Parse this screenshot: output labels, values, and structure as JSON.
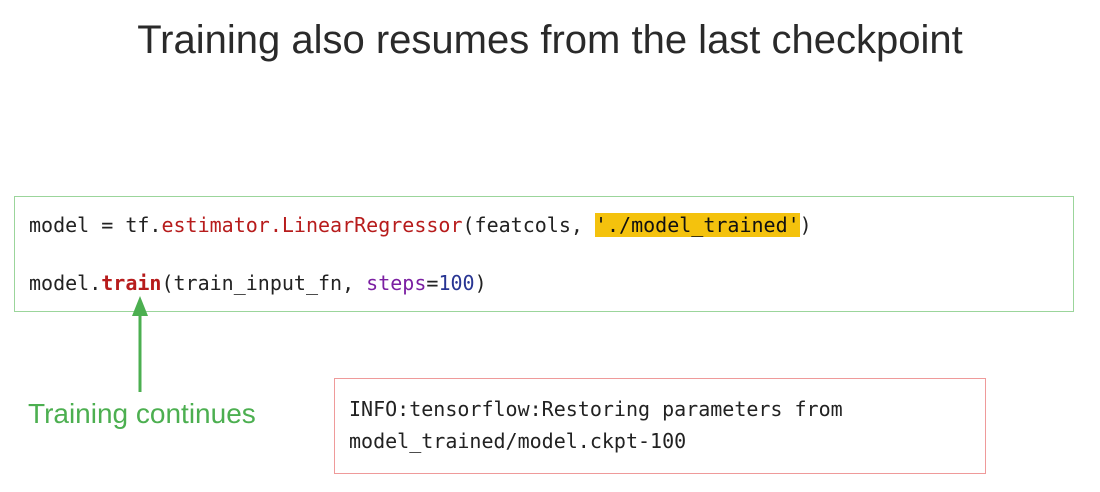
{
  "title": "Training also resumes from the last checkpoint",
  "code": {
    "line1": {
      "prefix": "model = tf.",
      "estimator": "estimator",
      "dot": ".",
      "cls": "LinearRegressor",
      "args_start": "(featcols, ",
      "path": "'./model_trained'",
      "args_end": ")"
    },
    "line2": {
      "prefix": "model.",
      "method": "train",
      "args_start": "(train_input_fn, ",
      "kwarg": "steps",
      "eq": "=",
      "value": "100",
      "args_end": ")"
    }
  },
  "annotation": {
    "label": "Training continues",
    "color": "#4caf50"
  },
  "log": {
    "line1": "INFO:tensorflow:Restoring parameters from",
    "line2": "model_trained/model.ckpt-100"
  }
}
